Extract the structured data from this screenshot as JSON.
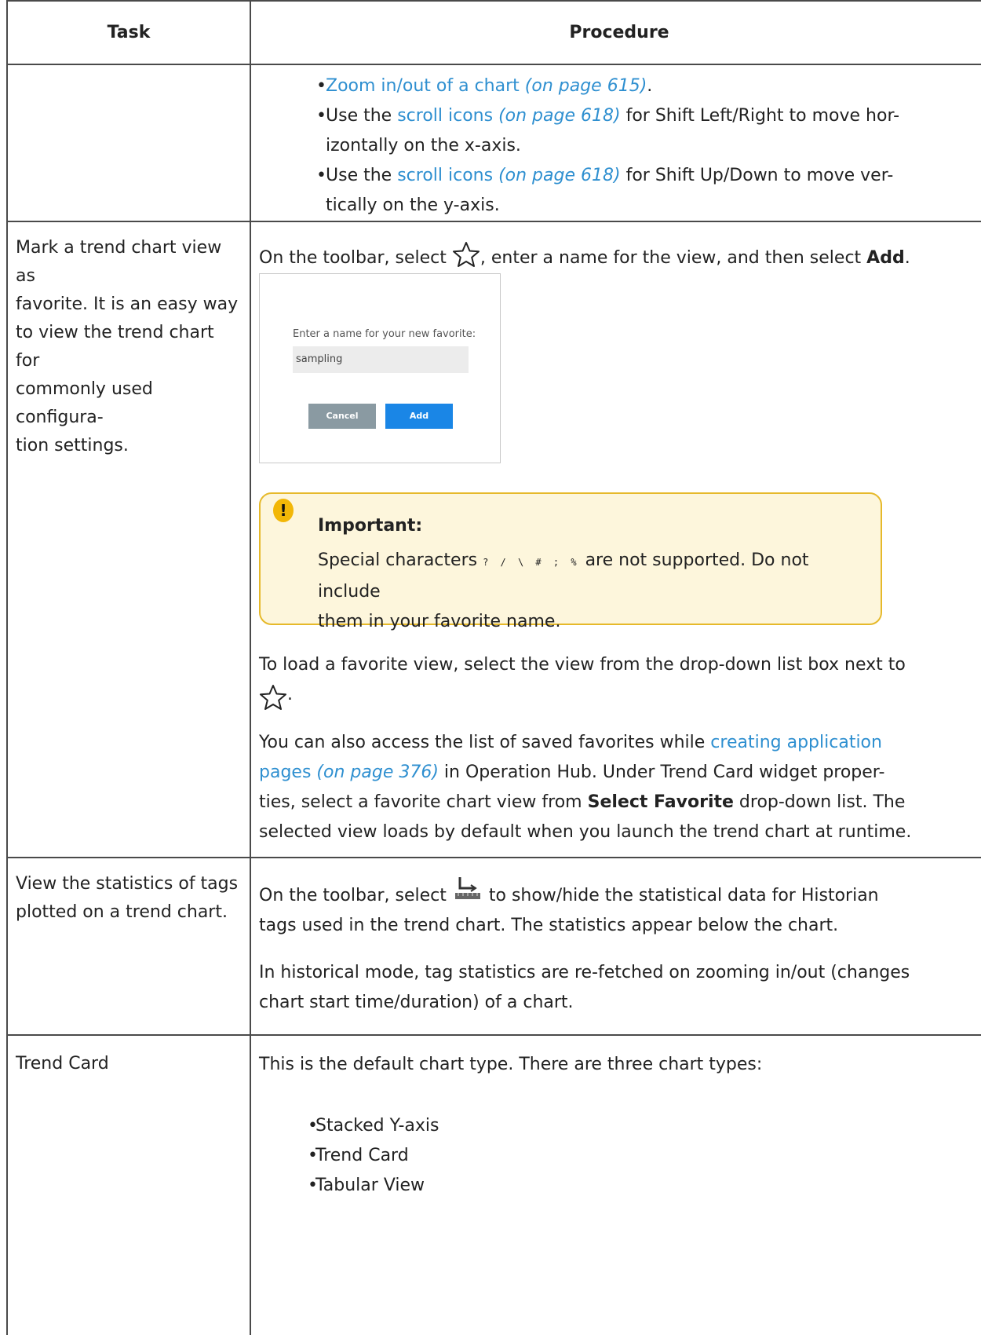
{
  "header": {
    "task": "Task",
    "procedure": "Procedure"
  },
  "row1": {
    "bullets": [
      {
        "link": "Zoom in/out of a chart",
        "page": "(on page 615)",
        "after": "."
      },
      {
        "before": "Use the ",
        "link": "scroll icons",
        "page": "(on page 618)",
        "line1": " for Shift Left/Right to move hor-",
        "line2": "izontally on the x-axis."
      },
      {
        "before": "Use the ",
        "link": "scroll icons",
        "page": "(on page 618)",
        "line1": " for Shift Up/Down to move ver-",
        "line2": "tically on the y-axis."
      }
    ]
  },
  "row2": {
    "task_lines": [
      "Mark a trend chart view as",
      "favorite. It is an easy way",
      "to view the trend chart for",
      "commonly used configura-",
      "tion settings."
    ],
    "intro_before": "On the toolbar, select",
    "intro_after": ", enter a name for the view, and then select",
    "intro_bold": "Add",
    "intro_end": ".",
    "dialog": {
      "prompt": "Enter a name for your new favorite:",
      "value": "sampling",
      "cancel": "Cancel",
      "add": "Add"
    },
    "note": {
      "badge": "!",
      "title": "Important:",
      "line1_before": "Special characters",
      "chars": "? / \\ # ; %",
      "line1_after": "are not supported. Do not include",
      "line2": "them in your favorite name."
    },
    "load_line": "To load a favorite view, select the view from the drop-down list box next to",
    "load_end": ".",
    "access": {
      "before": "You can also access the list of saved favorites while ",
      "link1": "creating application",
      "link2": "pages",
      "page": "(on page 376)",
      "line2_after": " in Operation Hub. Under Trend Card widget proper-",
      "line3_before": "ties, select a favorite chart view from ",
      "line3_bold": "Select Favorite",
      "line3_after": " drop-down list. The",
      "line4": "selected view loads by default when you launch the trend chart at runtime."
    }
  },
  "row3": {
    "task_lines": [
      "View the statistics of tags",
      "plotted on a trend chart."
    ],
    "line1_before": "On the toolbar, select",
    "line1_after": "to show/hide the statistical data for Historian",
    "line2": "tags used in the trend chart. The statistics appear below the chart.",
    "para2_line1": "In historical mode, tag statistics are re-fetched on zooming in/out (changes",
    "para2_line2": "chart start time/duration) of a chart."
  },
  "row4": {
    "task": "Trend Card",
    "intro": "This is the default chart type. There are three chart types:",
    "bullets": [
      "Stacked Y-axis",
      "Trend Card",
      "Tabular View"
    ]
  },
  "colors": {
    "link": "#2e8fd0",
    "note_border": "#e6b92a",
    "note_bg": "#fdf6dc",
    "add_button": "#1a86e6",
    "cancel_button": "#8a9aa2"
  }
}
